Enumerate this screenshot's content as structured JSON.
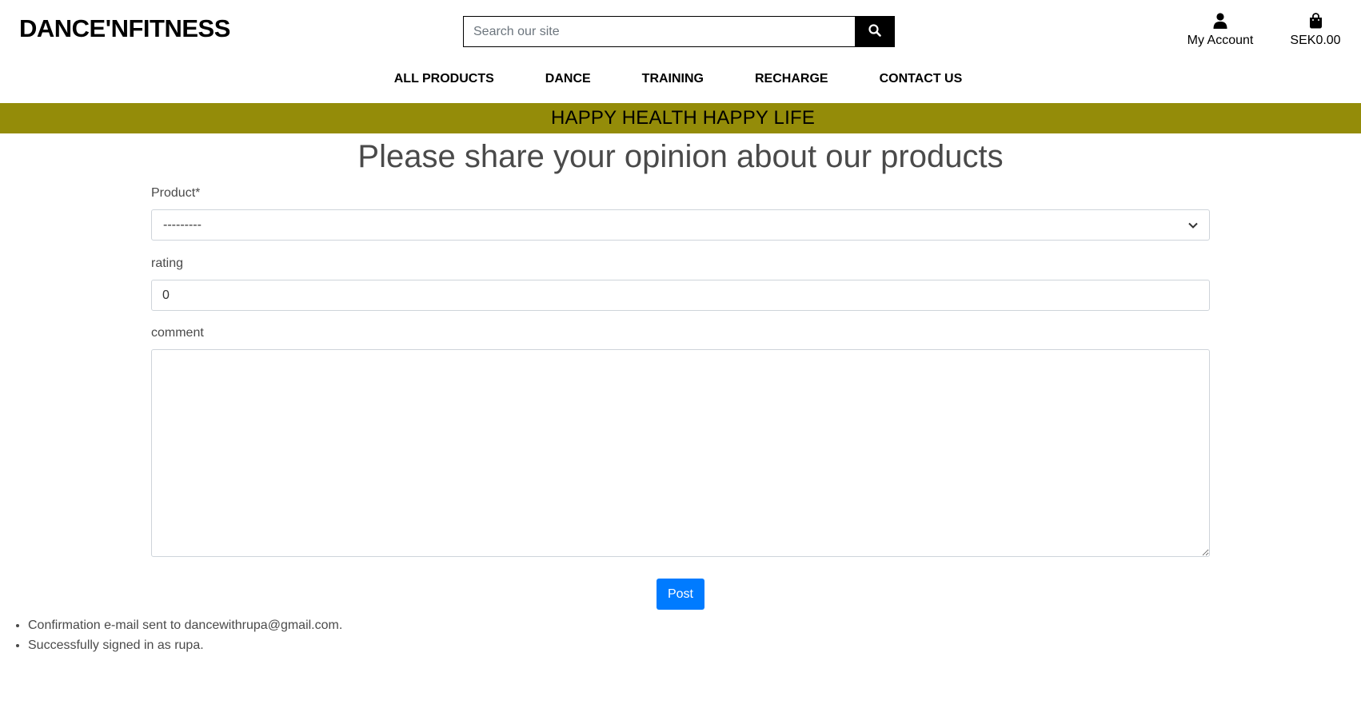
{
  "header": {
    "brand": "DANCE'NFITNESS",
    "search": {
      "placeholder": "Search our site",
      "value": ""
    },
    "account_label": "My Account",
    "bag_label": "SEK0.00"
  },
  "nav": {
    "items": [
      "ALL PRODUCTS",
      "DANCE",
      "TRAINING",
      "RECHARGE",
      "CONTACT US"
    ]
  },
  "banner": {
    "text": "HAPPY HEALTH HAPPY LIFE"
  },
  "form": {
    "heading": "Please share your opinion about our products",
    "product_label": "Product*",
    "product_selected": "---------",
    "rating_label": "rating",
    "rating_value": "0",
    "comment_label": "comment",
    "comment_value": "",
    "post_label": "Post"
  },
  "messages": [
    "Confirmation e-mail sent to dancewithrupa@gmail.com.",
    "Successfully signed in as rupa."
  ],
  "colors": {
    "banner_bg": "#948c09",
    "primary_button": "#007bff",
    "search_button": "#000000"
  },
  "icons": {
    "search": "search-icon",
    "account": "user-icon",
    "bag": "shopping-bag-icon",
    "select": "chevron-down-icon"
  }
}
